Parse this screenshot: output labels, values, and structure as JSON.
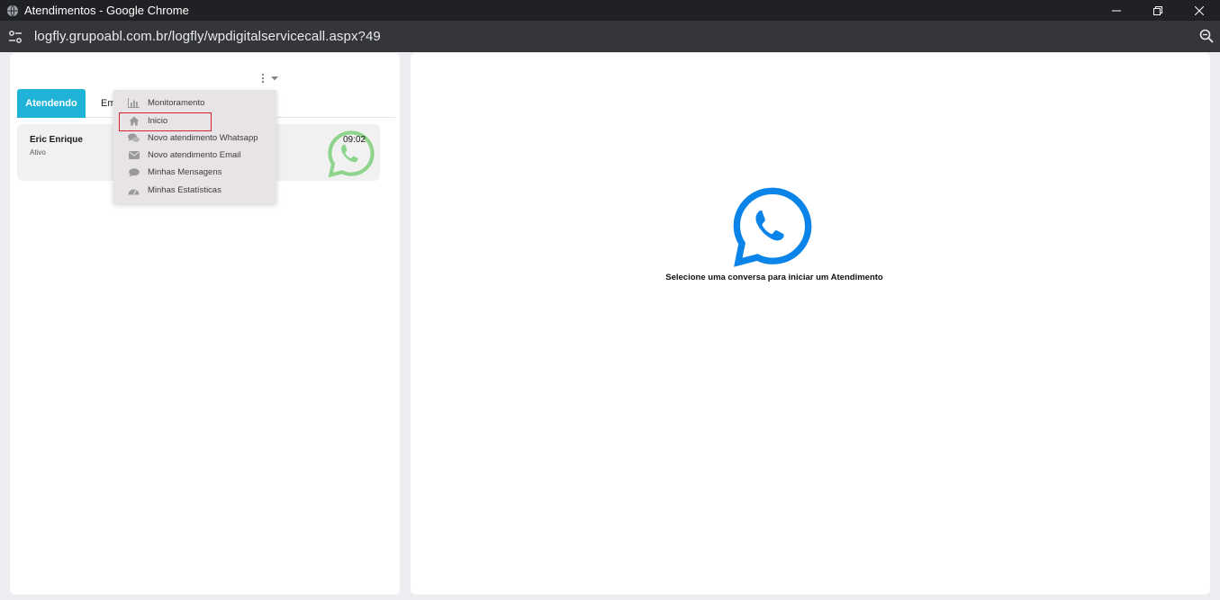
{
  "window": {
    "title": "Atendimentos - Google Chrome",
    "url": "logfly.grupoabl.com.br/logfly/wpdigitalservicecall.aspx?49"
  },
  "tabs": [
    {
      "label": "Atendendo",
      "active": true
    },
    {
      "label": "Em",
      "active": false
    }
  ],
  "conversation": {
    "name": "Eric Enrique",
    "status": "Ativo",
    "time": "09:02"
  },
  "menu": {
    "items": [
      {
        "label": "Monitoramento",
        "icon": "bar-chart-icon"
      },
      {
        "label": "Inicio",
        "icon": "home-icon"
      },
      {
        "label": "Novo atendimento Whatsapp",
        "icon": "chat-bubbles-icon"
      },
      {
        "label": "Novo atendimento Email",
        "icon": "envelope-icon"
      },
      {
        "label": "Minhas Mensagens",
        "icon": "comment-icon"
      },
      {
        "label": "Minhas Estatísticas",
        "icon": "dashboard-icon"
      }
    ],
    "highlighted_index": 1
  },
  "empty_state": {
    "message": "Selecione uma conversa para iniciar um Atendimento"
  },
  "colors": {
    "accent": "#1fb3d8",
    "whatsapp_blue": "#0a84e8",
    "whatsapp_green": "#3fbe3c",
    "highlight_border": "#d9262b"
  }
}
